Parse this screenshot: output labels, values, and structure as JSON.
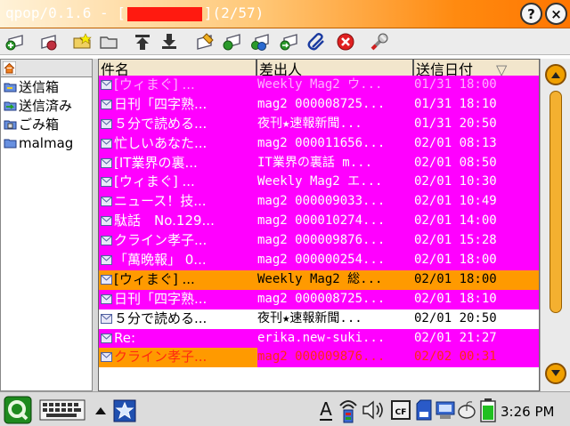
{
  "window": {
    "title_prefix": "qpop/0.1.6 - [",
    "title_suffix": "](2/57)",
    "help_label": "?",
    "close_label": "×"
  },
  "toolbar": {
    "items": [
      "get-mail-icon",
      "send-mail-icon",
      "open-folder-icon",
      "folder-icon",
      "up-icon",
      "down-icon",
      "compose-icon",
      "reply-icon",
      "reply-all-icon",
      "forward-icon",
      "attach-icon",
      "delete-icon",
      "settings-icon"
    ]
  },
  "folders": {
    "root_icon": "home-icon",
    "items": [
      {
        "label": "送信箱",
        "icon": "outbox-icon"
      },
      {
        "label": "送信済み",
        "icon": "sent-icon"
      },
      {
        "label": "ごみ箱",
        "icon": "trash-icon"
      },
      {
        "label": "malmag",
        "icon": "folder-icon"
      }
    ]
  },
  "list": {
    "columns": {
      "subject": "件名",
      "from": "差出人",
      "date": "送信日付"
    },
    "sort_indicator": "▽",
    "rows": [
      {
        "subject": "[ウィまぐ] ...",
        "from": "Weekly Mag2 ウ...",
        "date": "01/31 18:00",
        "style": "magenta-dim",
        "partial": true
      },
      {
        "subject": "日刊「四字熟...",
        "from": "mag2 000008725...",
        "date": "01/31 18:10",
        "style": "magenta"
      },
      {
        "subject": "５分で読める...",
        "from": "夜刊★速報新聞...",
        "date": "01/31 20:50",
        "style": "magenta"
      },
      {
        "subject": "忙しいあなた...",
        "from": "mag2 000011656...",
        "date": "02/01 08:13",
        "style": "magenta"
      },
      {
        "subject": "[IT業界の裏...",
        "from": "IT業界の裏話 m...",
        "date": "02/01 08:50",
        "style": "magenta"
      },
      {
        "subject": "[ウィまぐ] ...",
        "from": "Weekly Mag2 エ...",
        "date": "02/01 10:30",
        "style": "magenta"
      },
      {
        "subject": "ニュース！技...",
        "from": "mag2 000009033...",
        "date": "02/01 10:49",
        "style": "magenta"
      },
      {
        "subject": "駄話　No.129...",
        "from": "mag2 000010274...",
        "date": "02/01 14:00",
        "style": "magenta"
      },
      {
        "subject": "クライン孝子...",
        "from": "mag2 000009876...",
        "date": "02/01 15:28",
        "style": "magenta"
      },
      {
        "subject": "「萬晩報」 0...",
        "from": "mag2 000000254...",
        "date": "02/01 18:00",
        "style": "magenta"
      },
      {
        "subject": "[ウィまぐ] ...",
        "from": "Weekly Mag2 総...",
        "date": "02/01 18:00",
        "style": "orange"
      },
      {
        "subject": "日刊「四字熟...",
        "from": "mag2 000008725...",
        "date": "02/01 18:10",
        "style": "magenta"
      },
      {
        "subject": "５分で読める...",
        "from": "夜刊★速報新聞...",
        "date": "02/01 20:50",
        "style": "white"
      },
      {
        "subject": "Re:",
        "from": "erika.new-suki...",
        "date": "02/01 21:27",
        "style": "magenta"
      },
      {
        "subject": "クライン孝子...",
        "from": "mag2 000009876...",
        "date": "02/02 00:31",
        "style": "red-orange",
        "partial": true
      }
    ]
  },
  "taskbar": {
    "items": [
      "q-launcher-icon",
      "keyboard-icon",
      "up-arrow-icon",
      "app-icon",
      "input-method-icon",
      "wireless-icon",
      "volume-icon",
      "cf-card-icon",
      "sd-card-icon",
      "network-icon",
      "mouse-icon",
      "battery-icon"
    ],
    "input_method_label": "A",
    "cf_label": "CF",
    "clock": "3:26 PM"
  }
}
